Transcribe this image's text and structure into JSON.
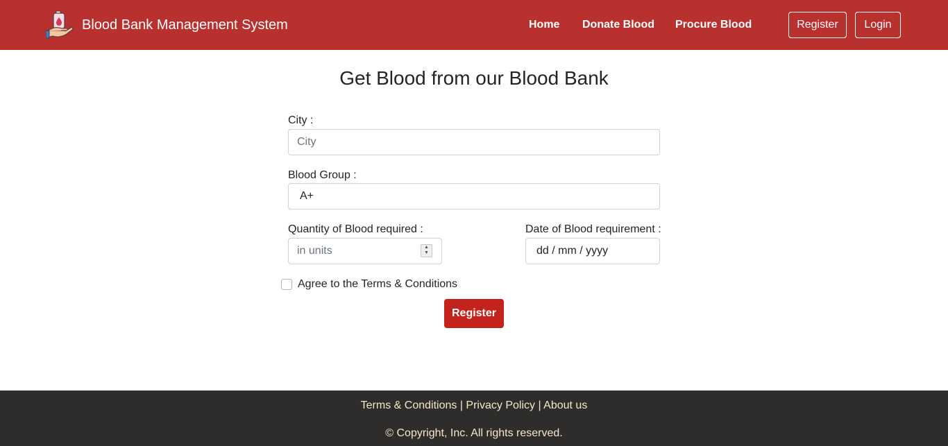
{
  "navbar": {
    "brand": "Blood Bank Management System",
    "links": [
      "Home",
      "Donate Blood",
      "Procure Blood"
    ],
    "register_label": "Register",
    "login_label": "Login",
    "background": "#b8312f"
  },
  "page": {
    "title": "Get Blood from our Blood Bank"
  },
  "form": {
    "city_label": "City :",
    "city_placeholder": "City",
    "blood_group_label": "Blood Group :",
    "blood_group_value": "A+",
    "quantity_label": "Quantity of Blood required :",
    "quantity_placeholder": "in units",
    "date_label": "Date of Blood requirement :",
    "date_value": "dd / mm / yyyy",
    "terms_label": "Agree to the Terms & Conditions",
    "submit_label": "Register",
    "submit_color": "#c4221c"
  },
  "footer": {
    "links": [
      "Terms & Conditions",
      "Privacy Policy",
      "About us"
    ],
    "separator": " | ",
    "copyright": "© Copyright, Inc. All rights reserved.",
    "background": "#2f2d2c"
  }
}
